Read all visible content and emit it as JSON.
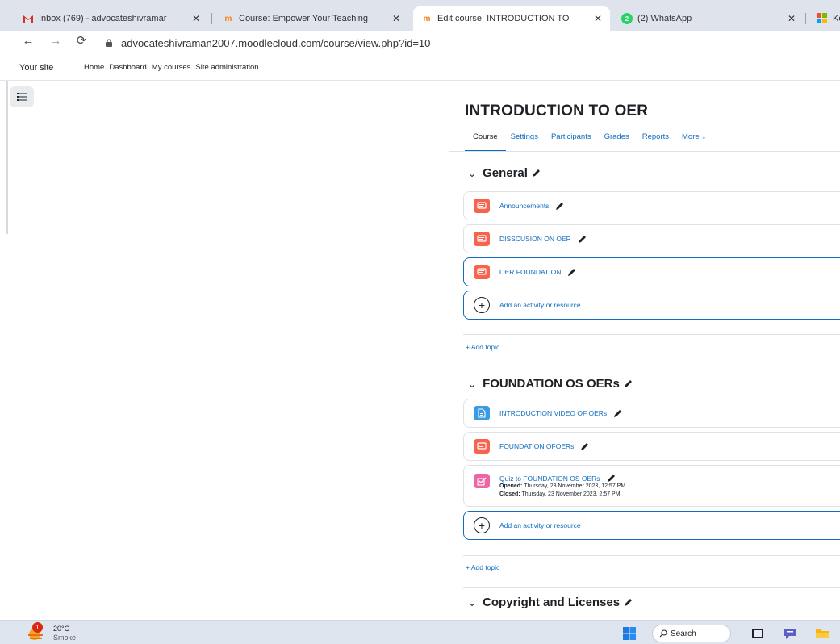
{
  "browser": {
    "tabs": [
      {
        "title": "Inbox (769) - advocateshivramar",
        "icon": "gmail-icon",
        "active": false
      },
      {
        "title": "Course: Empower Your Teaching",
        "icon": "moodle-icon",
        "active": false
      },
      {
        "title": "Edit course: INTRODUCTION TO",
        "icon": "moodle-icon",
        "active": true
      },
      {
        "title": "(2) WhatsApp",
        "icon": "whatsapp-icon",
        "active": false
      },
      {
        "title": "Ke",
        "icon": "microsoft-icon",
        "active": false
      }
    ],
    "whatsapp_badge": "2",
    "url": "advocateshivraman2007.moodlecloud.com/course/view.php?id=10"
  },
  "moodle": {
    "site_name": "Your site",
    "nav_links": [
      "Home",
      "Dashboard",
      "My courses",
      "Site administration"
    ]
  },
  "course": {
    "title": "INTRODUCTION TO OER",
    "tabs": [
      "Course",
      "Settings",
      "Participants",
      "Grades",
      "Reports",
      "More"
    ],
    "add_topic_label": "+ Add topic",
    "add_activity_label": "Add an activity or resource",
    "sections": [
      {
        "title": "General",
        "activities": [
          {
            "name": "Announcements",
            "type": "forum-icon"
          },
          {
            "name": "DISSCUSION ON OER",
            "type": "forum-icon"
          },
          {
            "name": "OER FOUNDATION",
            "type": "forum-icon"
          }
        ]
      },
      {
        "title": "FOUNDATION OS OERs",
        "activities": [
          {
            "name": "INTRODUCTION VIDEO OF OERs",
            "type": "page-icon"
          },
          {
            "name": "FOUNDATION OFOERs",
            "type": "forum-icon"
          },
          {
            "name": "Quiz to FOUNDATION OS OERs",
            "type": "quiz-icon",
            "opened_label": "Opened:",
            "opened_value": "Thursday, 23 November 2023, 12:57 PM",
            "closed_label": "Closed:",
            "closed_value": "Thursday, 23 November 2023, 2:57 PM"
          }
        ]
      },
      {
        "title": "Copyright and Licenses",
        "activities": []
      }
    ]
  },
  "taskbar": {
    "weather_temp": "20°C",
    "weather_desc": "Smoke",
    "weather_badge": "1",
    "search_label": "Search"
  },
  "colors": {
    "link": "#0f6cbf",
    "forum": "#f7634d",
    "page": "#399be2",
    "quiz": "#eb66a2"
  }
}
